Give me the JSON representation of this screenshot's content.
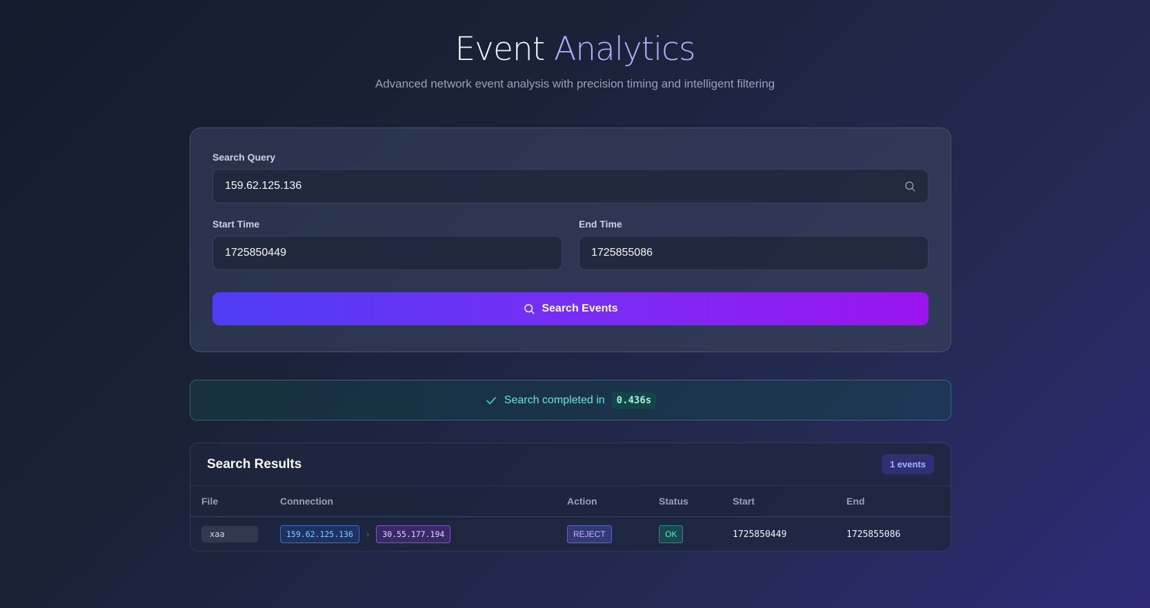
{
  "header": {
    "title_main": "Event ",
    "title_accent": "Analytics",
    "subtitle": "Advanced network event analysis with precision timing and intelligent filtering"
  },
  "search_form": {
    "query_label": "Search Query",
    "query_value": "159.62.125.136",
    "start_label": "Start Time",
    "start_value": "1725850449",
    "end_label": "End Time",
    "end_value": "1725855086",
    "button_label": "Search Events"
  },
  "status": {
    "message": "Search completed in",
    "duration": "0.436s"
  },
  "results": {
    "title": "Search Results",
    "count_label": "1 events",
    "columns": {
      "file": "File",
      "connection": "Connection",
      "action": "Action",
      "status": "Status",
      "start": "Start",
      "end": "End"
    },
    "rows": [
      {
        "file": "xaa",
        "src_ip": "159.62.125.136",
        "arrow": "›",
        "dst_ip": "30.55.177.194",
        "action": "REJECT",
        "status": "OK",
        "start": "1725850449",
        "end": "1725855086"
      }
    ]
  },
  "icons": {
    "search": "search-icon",
    "check": "check-icon"
  },
  "colors": {
    "accent": "#a5b4fc",
    "button_start": "#4f3df5",
    "button_end": "#9b14f0",
    "success": "#5eead4"
  }
}
